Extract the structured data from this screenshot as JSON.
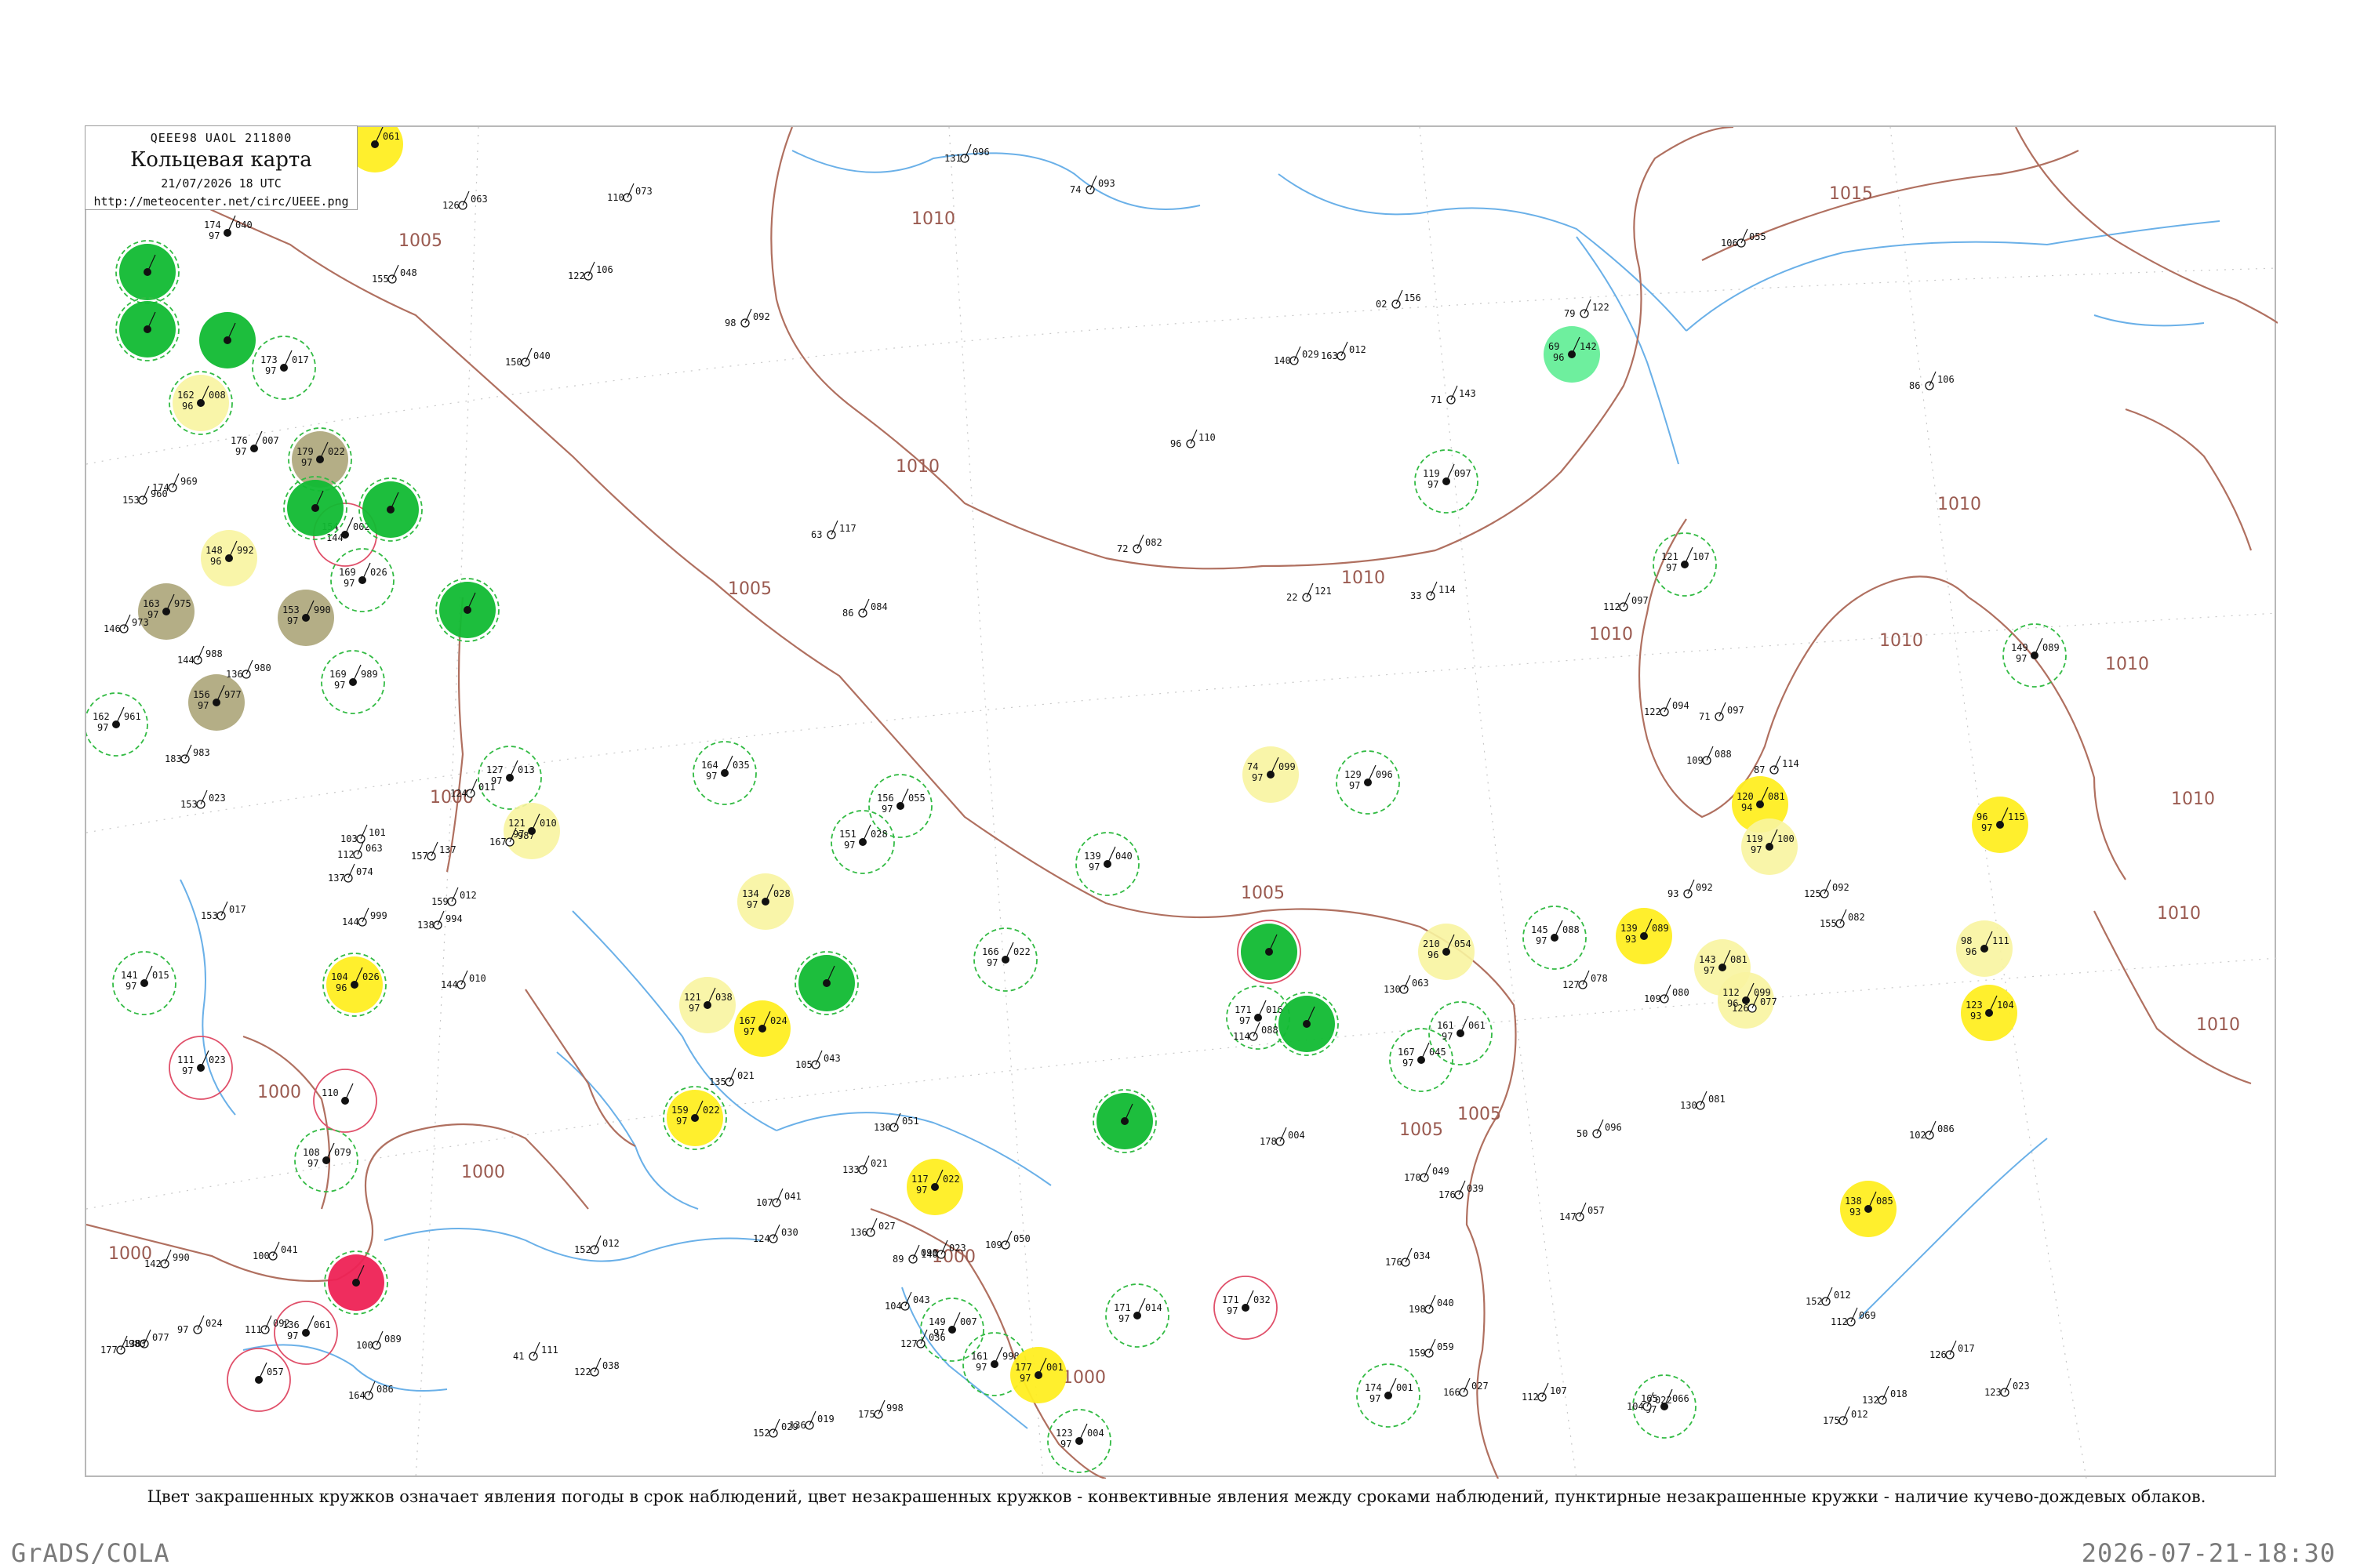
{
  "header": {
    "code": "QEEE98  UAOL  211800",
    "title": "Кольцевая карта",
    "time": "21/07/2026 18 UTC",
    "url": "http://meteocenter.net/circ/UEEE.png"
  },
  "caption": "Цвет закрашенных кружков означает явления погоды в срок наблюдений, цвет незакрашенных кружков - конвективные явления между сроками наблюдений, пунктирные незакрашенные кружки - наличие кучево-дождевых облаков.",
  "footer": {
    "left": "GrADS/COLA",
    "right": "2026-07-21-18:30"
  },
  "colors": {
    "isobar": "#b07060",
    "river": "#6ab0e8",
    "dash_ring": "#33bb44",
    "red_ring": "#e0506a",
    "green_fill": "#11bb33",
    "olive_fill": "#b0aa80",
    "yellow_fill": "#ffee22",
    "pale_yellow_fill": "#f8f4a0",
    "red_fill": "#ee2255",
    "mint_fill": "#66ee99"
  },
  "isobar_labels": [
    "1005",
    "1010",
    "1015",
    "1010",
    "1005",
    "1010",
    "1010",
    "1000",
    "1005",
    "1010",
    "1005",
    "1000",
    "1010",
    "1010",
    "1010",
    "1005",
    "1000",
    "1000",
    "1000",
    "1000",
    "1010",
    "1010"
  ],
  "stations": [
    {
      "id": "s1",
      "p": "061",
      "t": "",
      "d": "",
      "fill": "yellow",
      "ring": ""
    },
    {
      "id": "s2",
      "p": "040",
      "t": "174",
      "d": "97",
      "fill": "",
      "ring": ""
    },
    {
      "id": "s3",
      "p": "",
      "t": "",
      "d": "",
      "fill": "green",
      "ring": "dash"
    },
    {
      "id": "s4",
      "p": "",
      "t": "",
      "d": "",
      "fill": "green",
      "ring": "dash"
    },
    {
      "id": "s5",
      "p": "",
      "t": "",
      "d": "",
      "fill": "green",
      "ring": ""
    },
    {
      "id": "s6",
      "p": "017",
      "t": "173",
      "d": "97",
      "fill": "",
      "ring": "dash"
    },
    {
      "id": "s7",
      "p": "008",
      "t": "162",
      "d": "96",
      "fill": "pale",
      "ring": "dash"
    },
    {
      "id": "s8",
      "p": "007",
      "t": "176",
      "d": "97",
      "fill": "",
      "ring": ""
    },
    {
      "id": "s9",
      "p": "002",
      "t": "154",
      "d": "144",
      "fill": "",
      "ring": "red"
    },
    {
      "id": "s10",
      "p": "992",
      "t": "148",
      "d": "96",
      "fill": "pale",
      "ring": ""
    },
    {
      "id": "s11",
      "p": "975",
      "t": "163",
      "d": "97",
      "fill": "olive",
      "ring": ""
    },
    {
      "id": "s12",
      "p": "990",
      "t": "153",
      "d": "97",
      "fill": "olive",
      "ring": ""
    },
    {
      "id": "s13",
      "p": "977",
      "t": "156",
      "d": "97",
      "fill": "olive",
      "ring": ""
    },
    {
      "id": "s14",
      "p": "961",
      "t": "162",
      "d": "97",
      "fill": "",
      "ring": "dash"
    },
    {
      "id": "s15",
      "p": "989",
      "t": "169",
      "d": "97",
      "fill": "",
      "ring": "dash"
    },
    {
      "id": "s16",
      "p": "022",
      "t": "179",
      "d": "97",
      "fill": "olive",
      "ring": "dash"
    },
    {
      "id": "s17",
      "p": "",
      "t": "",
      "d": "",
      "fill": "green",
      "ring": "dash"
    },
    {
      "id": "s18",
      "p": "",
      "t": "",
      "d": "",
      "fill": "green",
      "ring": "dash"
    },
    {
      "id": "s19",
      "p": "026",
      "t": "169",
      "d": "97",
      "fill": "",
      "ring": "dash"
    },
    {
      "id": "s20",
      "p": "",
      "t": "",
      "d": "",
      "fill": "green",
      "ring": "dash"
    },
    {
      "id": "s21",
      "p": "015",
      "t": "141",
      "d": "97",
      "fill": "",
      "ring": "dash"
    },
    {
      "id": "s22",
      "p": "026",
      "t": "104",
      "d": "96",
      "fill": "yellow",
      "ring": "dash"
    },
    {
      "id": "s23",
      "p": "023",
      "t": "111",
      "d": "97",
      "fill": "",
      "ring": "red"
    },
    {
      "id": "s24",
      "p": "",
      "t": "110",
      "d": "",
      "fill": "",
      "ring": "red"
    },
    {
      "id": "s25",
      "p": "079",
      "t": "108",
      "d": "97",
      "fill": "",
      "ring": "dash"
    },
    {
      "id": "s26",
      "p": "",
      "t": "",
      "d": "",
      "fill": "red",
      "ring": "dash"
    },
    {
      "id": "s27",
      "p": "061",
      "t": "136",
      "d": "97",
      "fill": "",
      "ring": "red"
    },
    {
      "id": "s28",
      "p": "057",
      "t": "",
      "d": "",
      "fill": "",
      "ring": "red"
    },
    {
      "id": "s29",
      "p": "013",
      "t": "127",
      "d": "97",
      "fill": "",
      "ring": "dash"
    },
    {
      "id": "s30",
      "p": "010",
      "t": "121",
      "d": "97",
      "fill": "pale",
      "ring": ""
    },
    {
      "id": "s31",
      "p": "035",
      "t": "164",
      "d": "97",
      "fill": "",
      "ring": "dash"
    },
    {
      "id": "s32",
      "p": "028",
      "t": "134",
      "d": "97",
      "fill": "pale",
      "ring": ""
    },
    {
      "id": "s33",
      "p": "",
      "t": "",
      "d": "",
      "fill": "green",
      "ring": "dash"
    },
    {
      "id": "s34",
      "p": "038",
      "t": "121",
      "d": "97",
      "fill": "pale",
      "ring": ""
    },
    {
      "id": "s35",
      "p": "024",
      "t": "167",
      "d": "97",
      "fill": "yellow",
      "ring": ""
    },
    {
      "id": "s36",
      "p": "022",
      "t": "159",
      "d": "97",
      "fill": "yellow",
      "ring": "dash"
    },
    {
      "id": "s37",
      "p": "055",
      "t": "156",
      "d": "97",
      "fill": "",
      "ring": "dash"
    },
    {
      "id": "s38",
      "p": "028",
      "t": "151",
      "d": "97",
      "fill": "",
      "ring": "dash"
    },
    {
      "id": "s39",
      "p": "022",
      "t": "166",
      "d": "97",
      "fill": "",
      "ring": "dash"
    },
    {
      "id": "s40",
      "p": "040",
      "t": "139",
      "d": "97",
      "fill": "",
      "ring": "dash"
    },
    {
      "id": "s41",
      "p": "",
      "t": "",
      "d": "",
      "fill": "green",
      "ring": "dash"
    },
    {
      "id": "s42",
      "p": "022",
      "t": "117",
      "d": "97",
      "fill": "yellow",
      "ring": ""
    },
    {
      "id": "s43",
      "p": "007",
      "t": "149",
      "d": "97",
      "fill": "",
      "ring": "dash"
    },
    {
      "id": "s44",
      "p": "998",
      "t": "161",
      "d": "97",
      "fill": "",
      "ring": "dash"
    },
    {
      "id": "s45",
      "p": "001",
      "t": "177",
      "d": "97",
      "fill": "yellow",
      "ring": ""
    },
    {
      "id": "s46",
      "p": "004",
      "t": "123",
      "d": "97",
      "fill": "",
      "ring": "dash"
    },
    {
      "id": "s47",
      "p": "014",
      "t": "171",
      "d": "97",
      "fill": "",
      "ring": "dash"
    },
    {
      "id": "s48",
      "p": "032",
      "t": "171",
      "d": "97",
      "fill": "",
      "ring": "red"
    },
    {
      "id": "s49",
      "p": "099",
      "t": "74",
      "d": "97",
      "fill": "pale",
      "ring": ""
    },
    {
      "id": "s50",
      "p": "",
      "t": "",
      "d": "",
      "fill": "green",
      "ring": "red"
    },
    {
      "id": "s51",
      "p": "016",
      "t": "171",
      "d": "97",
      "fill": "",
      "ring": "dash"
    },
    {
      "id": "s52",
      "p": "",
      "t": "",
      "d": "",
      "fill": "green",
      "ring": "dash"
    },
    {
      "id": "s53",
      "p": "096",
      "t": "129",
      "d": "97",
      "fill": "",
      "ring": "dash"
    },
    {
      "id": "s54",
      "p": "054",
      "t": "210",
      "d": "96",
      "fill": "pale",
      "ring": ""
    },
    {
      "id": "s55",
      "p": "045",
      "t": "167",
      "d": "97",
      "fill": "",
      "ring": "dash"
    },
    {
      "id": "s56",
      "p": "061",
      "t": "161",
      "d": "97",
      "fill": "",
      "ring": "dash"
    },
    {
      "id": "s57",
      "p": "001",
      "t": "174",
      "d": "97",
      "fill": "",
      "ring": "dash"
    },
    {
      "id": "s58",
      "p": "097",
      "t": "119",
      "d": "97",
      "fill": "",
      "ring": "dash"
    },
    {
      "id": "s59",
      "p": "142",
      "t": "69",
      "d": "96",
      "fill": "mint",
      "ring": ""
    },
    {
      "id": "s60",
      "p": "107",
      "t": "121",
      "d": "97",
      "fill": "",
      "ring": "dash"
    },
    {
      "id": "s61",
      "p": "089",
      "t": "149",
      "d": "97",
      "fill": "",
      "ring": "dash"
    },
    {
      "id": "s62",
      "p": "088",
      "t": "145",
      "d": "97",
      "fill": "",
      "ring": "dash"
    },
    {
      "id": "s63",
      "p": "089",
      "t": "139",
      "d": "93",
      "fill": "yellow",
      "ring": ""
    },
    {
      "id": "s64",
      "p": "081",
      "t": "143",
      "d": "97",
      "fill": "pale",
      "ring": ""
    },
    {
      "id": "s65",
      "p": "099",
      "t": "112",
      "d": "96",
      "fill": "pale",
      "ring": ""
    },
    {
      "id": "s66",
      "p": "081",
      "t": "120",
      "d": "94",
      "fill": "yellow",
      "ring": ""
    },
    {
      "id": "s67",
      "p": "100",
      "t": "119",
      "d": "97",
      "fill": "pale",
      "ring": ""
    },
    {
      "id": "s68",
      "p": "115",
      "t": "96",
      "d": "97",
      "fill": "yellow",
      "ring": ""
    },
    {
      "id": "s69",
      "p": "111",
      "t": "98",
      "d": "96",
      "fill": "pale",
      "ring": ""
    },
    {
      "id": "s70",
      "p": "104",
      "t": "123",
      "d": "93",
      "fill": "yellow",
      "ring": ""
    },
    {
      "id": "s71",
      "p": "085",
      "t": "138",
      "d": "93",
      "fill": "yellow",
      "ring": ""
    },
    {
      "id": "s72",
      "p": "066",
      "t": "165",
      "d": "97",
      "fill": "",
      "ring": "dash"
    }
  ],
  "plain_stations": [
    {
      "id": "q1",
      "t": "096",
      "b": "131"
    },
    {
      "id": "q2",
      "t": "093",
      "b": "74"
    },
    {
      "id": "q3",
      "t": "073",
      "b": "110"
    },
    {
      "id": "q4",
      "t": "063",
      "b": "126"
    },
    {
      "id": "q5",
      "t": "048",
      "b": "155"
    },
    {
      "id": "q6",
      "t": "106",
      "b": "122"
    },
    {
      "id": "q7",
      "t": "092",
      "b": "98"
    },
    {
      "id": "q8",
      "t": "040",
      "b": "150"
    },
    {
      "id": "q9",
      "t": "029",
      "b": "140"
    },
    {
      "id": "q10",
      "t": "055",
      "b": "106"
    },
    {
      "id": "q11",
      "t": "122",
      "b": "79"
    },
    {
      "id": "q12",
      "t": "156",
      "b": "02"
    },
    {
      "id": "q13",
      "t": "143",
      "b": "71"
    },
    {
      "id": "q14",
      "t": "012",
      "b": "163"
    },
    {
      "id": "q15",
      "t": "106",
      "b": "86"
    },
    {
      "id": "q16",
      "t": "110",
      "b": "96"
    },
    {
      "id": "q17",
      "t": "117",
      "b": "63"
    },
    {
      "id": "q18",
      "t": "084",
      "b": "86"
    },
    {
      "id": "q19",
      "t": "082",
      "b": "72"
    },
    {
      "id": "q20",
      "t": "121",
      "b": "22"
    },
    {
      "id": "q21",
      "t": "114",
      "b": "33"
    },
    {
      "id": "q22",
      "t": "097",
      "b": "112"
    },
    {
      "id": "q23",
      "t": "094",
      "b": "122"
    },
    {
      "id": "q24",
      "t": "097",
      "b": "71"
    },
    {
      "id": "q25",
      "t": "088",
      "b": "109"
    },
    {
      "id": "q26",
      "t": "114",
      "b": "87"
    },
    {
      "id": "q27",
      "t": "092",
      "b": "93"
    },
    {
      "id": "q28",
      "t": "092",
      "b": "125"
    },
    {
      "id": "q29",
      "t": "082",
      "b": "155"
    },
    {
      "id": "q30",
      "t": "078",
      "b": "127"
    },
    {
      "id": "q31",
      "t": "080",
      "b": "109"
    },
    {
      "id": "q32",
      "t": "077",
      "b": "126"
    },
    {
      "id": "q33",
      "t": "086",
      "b": "102"
    },
    {
      "id": "q34",
      "t": "096",
      "b": "50"
    },
    {
      "id": "q35",
      "t": "057",
      "b": "147"
    },
    {
      "id": "q36",
      "t": "039",
      "b": "176"
    },
    {
      "id": "q37",
      "t": "049",
      "b": "170"
    },
    {
      "id": "q38",
      "t": "034",
      "b": "176"
    },
    {
      "id": "q39",
      "t": "040",
      "b": "198"
    },
    {
      "id": "q40",
      "t": "059",
      "b": "159"
    },
    {
      "id": "q41",
      "t": "027",
      "b": "166"
    },
    {
      "id": "q42",
      "t": "004",
      "b": "178"
    },
    {
      "id": "q43",
      "t": "088",
      "b": "114"
    },
    {
      "id": "q44",
      "t": "069",
      "b": "112"
    },
    {
      "id": "q45",
      "t": "012",
      "b": "152"
    },
    {
      "id": "q46",
      "t": "017",
      "b": "126"
    },
    {
      "id": "q47",
      "t": "023",
      "b": "123"
    },
    {
      "id": "q48",
      "t": "018",
      "b": "132"
    },
    {
      "id": "q49",
      "t": "022",
      "b": "104"
    },
    {
      "id": "q50",
      "t": "036",
      "b": "127"
    },
    {
      "id": "q51",
      "t": "043",
      "b": "104"
    },
    {
      "id": "q52",
      "t": "023",
      "b": "140"
    },
    {
      "id": "q53",
      "t": "027",
      "b": "136"
    },
    {
      "id": "q54",
      "t": "041",
      "b": "107"
    },
    {
      "id": "q55",
      "t": "030",
      "b": "124"
    },
    {
      "id": "q56",
      "t": "021",
      "b": "133"
    },
    {
      "id": "q57",
      "t": "051",
      "b": "130"
    },
    {
      "id": "q58",
      "t": "043",
      "b": "105"
    },
    {
      "id": "q59",
      "t": "021",
      "b": "135"
    },
    {
      "id": "q60",
      "t": "012",
      "b": "152"
    },
    {
      "id": "q61",
      "t": "038",
      "b": "122"
    },
    {
      "id": "q62",
      "t": "029",
      "b": "152"
    },
    {
      "id": "q63",
      "t": "019",
      "b": "136"
    },
    {
      "id": "q64",
      "t": "050",
      "b": "109"
    },
    {
      "id": "q65",
      "t": "090",
      "b": "89"
    },
    {
      "id": "q66",
      "t": "111",
      "b": "41"
    },
    {
      "id": "q67",
      "t": "089",
      "b": "100"
    },
    {
      "id": "q68",
      "t": "092",
      "b": "111"
    },
    {
      "id": "q69",
      "t": "041",
      "b": "100"
    },
    {
      "id": "q70",
      "t": "024",
      "b": "97"
    },
    {
      "id": "q71",
      "t": "077",
      "b": "138"
    },
    {
      "id": "q72",
      "t": "086",
      "b": "164"
    },
    {
      "id": "q73",
      "t": "990",
      "b": "142"
    },
    {
      "id": "q74",
      "t": "983",
      "b": "177"
    },
    {
      "id": "q75",
      "t": "960",
      "b": "153"
    },
    {
      "id": "q76",
      "t": "969",
      "b": "174"
    },
    {
      "id": "q77",
      "t": "973",
      "b": "146"
    },
    {
      "id": "q78",
      "t": "988",
      "b": "144"
    },
    {
      "id": "q79",
      "t": "980",
      "b": "136"
    },
    {
      "id": "q80",
      "t": "983",
      "b": "183"
    },
    {
      "id": "q81",
      "t": "023",
      "b": "153"
    },
    {
      "id": "q82",
      "t": "017",
      "b": "153"
    },
    {
      "id": "q83",
      "t": "999",
      "b": "144"
    },
    {
      "id": "q84",
      "t": "010",
      "b": "144"
    },
    {
      "id": "q85",
      "t": "994",
      "b": "138"
    },
    {
      "id": "q86",
      "t": "012",
      "b": "159"
    },
    {
      "id": "q87",
      "t": "011",
      "b": "124"
    },
    {
      "id": "q88",
      "t": "987",
      "b": "167"
    },
    {
      "id": "q89",
      "t": "137",
      "b": "157"
    },
    {
      "id": "q90",
      "t": "063",
      "b": "112"
    },
    {
      "id": "q91",
      "t": "074",
      "b": "137"
    },
    {
      "id": "q92",
      "t": "101",
      "b": "103"
    },
    {
      "id": "q93",
      "t": "063",
      "b": "130"
    },
    {
      "id": "q94",
      "t": "081",
      "b": "130"
    },
    {
      "id": "q95",
      "t": "107",
      "b": "112"
    },
    {
      "id": "q96",
      "t": "012",
      "b": "175"
    },
    {
      "id": "q97",
      "t": "998",
      "b": "175"
    }
  ]
}
